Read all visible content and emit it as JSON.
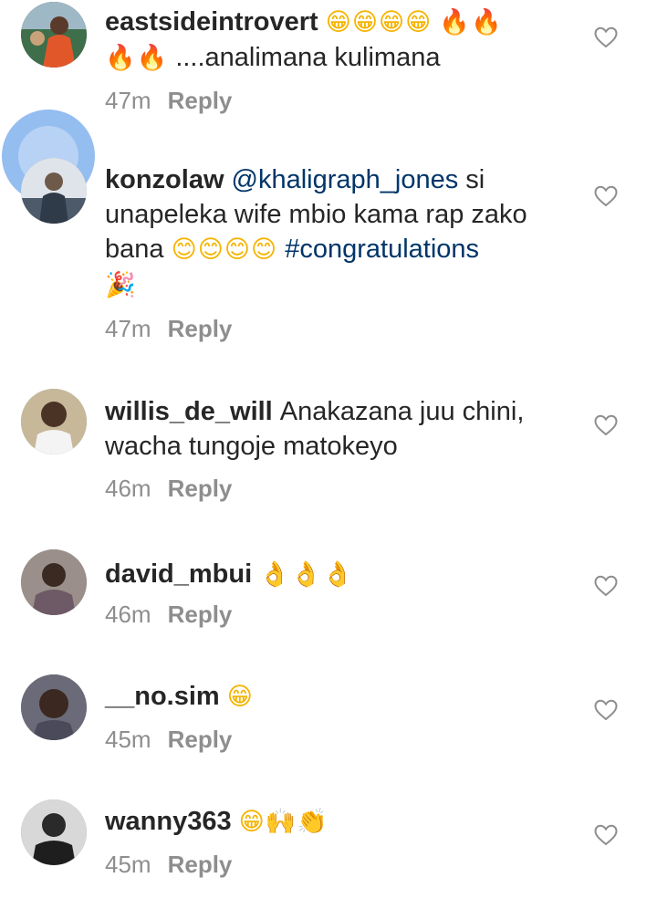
{
  "comments": [
    {
      "username": "eastsideintrovert",
      "text_parts": [
        {
          "kind": "emoji",
          "value": "😁😁😁😁",
          "icon": "grinning-face-emoji"
        },
        {
          "kind": "emoji",
          "value": "🔥🔥",
          "icon": "fire-emoji"
        },
        {
          "kind": "emoji",
          "value": "🔥🔥",
          "icon": "fire-emoji"
        },
        {
          "kind": "text",
          "value": "....analimana kulimana"
        }
      ],
      "time": "47m",
      "reply_label": "Reply",
      "like_icon": "heart-outline-icon"
    },
    {
      "username": "konzolaw",
      "text_parts": [
        {
          "kind": "mention",
          "value": "@khaligraph_jones"
        },
        {
          "kind": "text",
          "value": " si unapeleka wife mbio kama rap zako bana "
        },
        {
          "kind": "emoji",
          "value": "😊😊😊😊",
          "icon": "smiling-face-emoji"
        },
        {
          "kind": "hashtag",
          "value": " #congratulations"
        },
        {
          "kind": "emoji",
          "value": " 🎉",
          "icon": "party-popper-emoji"
        }
      ],
      "time": "47m",
      "reply_label": "Reply",
      "like_icon": "heart-outline-icon"
    },
    {
      "username": "willis_de_will",
      "text_parts": [
        {
          "kind": "text",
          "value": "Anakazana juu chini, wacha tungoje matokeyo"
        }
      ],
      "time": "46m",
      "reply_label": "Reply",
      "like_icon": "heart-outline-icon"
    },
    {
      "username": "david_mbui",
      "text_parts": [
        {
          "kind": "emoji",
          "value": "👌👌👌",
          "icon": "ok-hand-emoji"
        }
      ],
      "time": "46m",
      "reply_label": "Reply",
      "like_icon": "heart-outline-icon"
    },
    {
      "username": "__no.sim",
      "text_parts": [
        {
          "kind": "emoji",
          "value": "😁",
          "icon": "grinning-face-emoji"
        }
      ],
      "time": "45m",
      "reply_label": "Reply",
      "like_icon": "heart-outline-icon"
    },
    {
      "username": "wanny363",
      "text_parts": [
        {
          "kind": "emoji",
          "value": "😁🙌👏",
          "icon": "emoji-group"
        }
      ],
      "time": "45m",
      "reply_label": "Reply",
      "like_icon": "heart-outline-icon"
    }
  ],
  "colors": {
    "username": "#262626",
    "link": "#003569",
    "meta": "#8e8e8e",
    "touch_ripple": "#76aaec"
  }
}
